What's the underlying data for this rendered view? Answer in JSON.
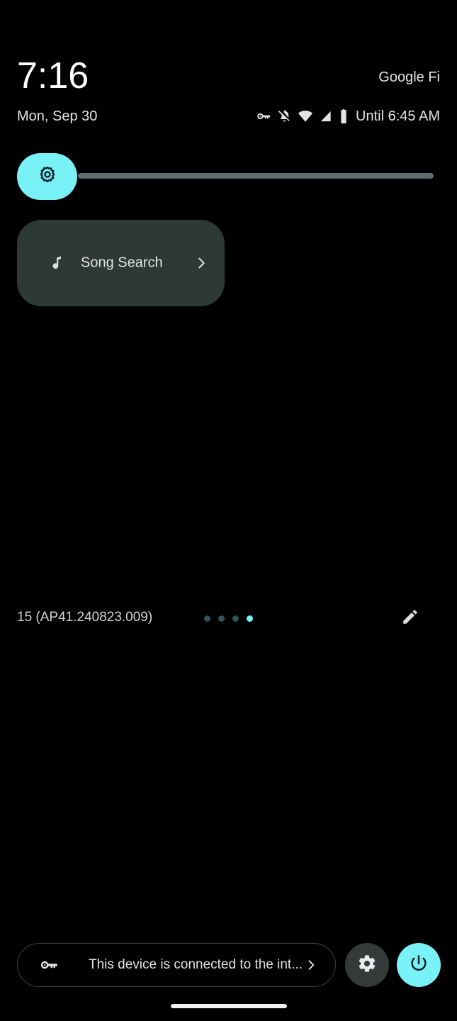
{
  "header": {
    "clock": "7:16",
    "carrier": "Google Fi",
    "date": "Mon, Sep 30",
    "status_text": "Until 6:45 AM",
    "status_icons": [
      {
        "name": "vpn-key-icon",
        "label": "VPN"
      },
      {
        "name": "notifications-muted-icon",
        "label": "Silent"
      },
      {
        "name": "wifi-icon",
        "label": "Wi-Fi"
      },
      {
        "name": "cellular-signal-icon",
        "label": "Signal"
      },
      {
        "name": "battery-icon",
        "label": "Battery"
      }
    ]
  },
  "brightness": {
    "icon": "brightness-icon",
    "label": "Brightness",
    "value_percent": 14,
    "thumb_color": "#79f2f7",
    "track_color": "#5f6b6d"
  },
  "tiles": [
    {
      "name": "song-search",
      "label": "Song Search",
      "icon": "music-note-icon",
      "chevron": "chevron-right-icon",
      "background": "#2c3935"
    }
  ],
  "footer": {
    "build_label": "15 (AP41.240823.009)",
    "edit_icon": "edit-pencil-icon",
    "pages": {
      "count": 4,
      "active_index": 3,
      "active_color": "#79f2f7",
      "inactive_color": "#2e5557"
    }
  },
  "bottom_bar": {
    "vpn_pill": {
      "icon": "vpn-key-icon",
      "text": "This device is connected to the int...",
      "chevron": "chevron-right-icon"
    },
    "settings_button": {
      "icon": "gear-icon",
      "label": "Settings",
      "background": "#333a37"
    },
    "power_button": {
      "icon": "power-icon",
      "label": "Power",
      "background": "#79f2f7"
    }
  },
  "nav_bar": {
    "label": "Home gesture bar",
    "color": "#f1f1f1"
  }
}
